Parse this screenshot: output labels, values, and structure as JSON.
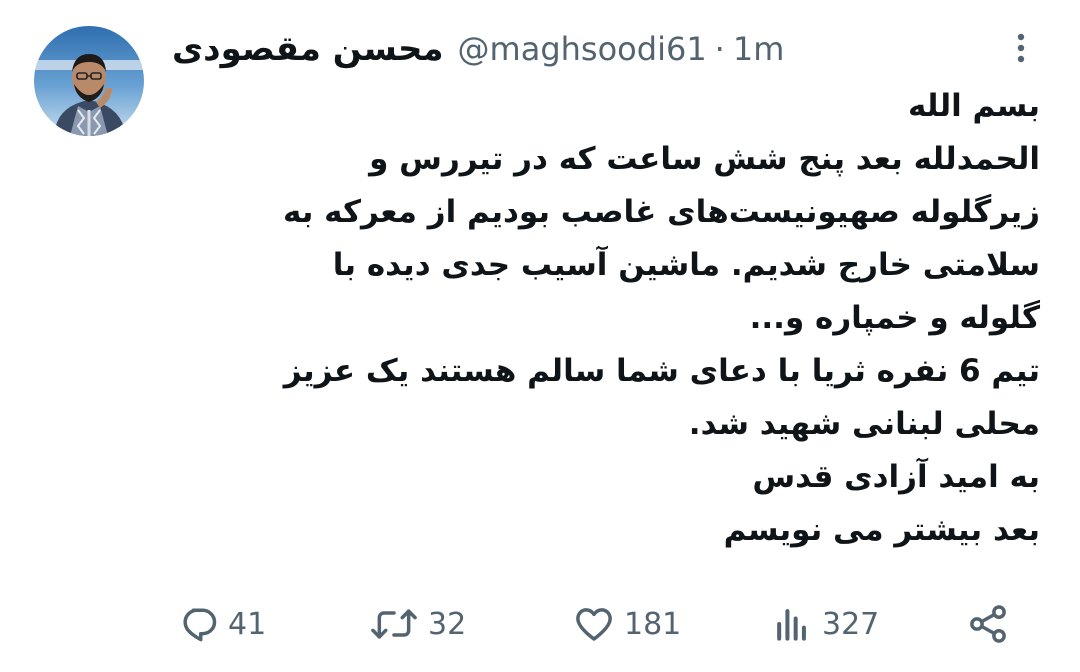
{
  "tweet": {
    "display_name": "محسن مقصودی",
    "handle": "@maghsoodi61",
    "separator": "·",
    "time": "1m",
    "more_icon": "more-dots-vertical-icon",
    "body_lines": [
      "بسم الله",
      "الحمدلله بعد پنج شش ساعت که در تیررس و",
      "زیرگلوله صهیونیست‌های غاصب بودیم از معرکه به",
      "سلامتی خارج شدیم. ماشین آسیب جدی دیده با",
      "گلوله و خمپاره و...",
      "تیم 6 نفره ثریا با دعای شما سالم هستند یک عزیز",
      "محلی لبنانی شهید شد.",
      "به امید آزادی قدس",
      "بعد بیشتر می نویسم"
    ],
    "actions": {
      "replies": "41",
      "retweets": "32",
      "likes": "181",
      "views": "327"
    }
  },
  "colors": {
    "text": "#0f1419",
    "secondary": "#536471",
    "background": "#ffffff"
  }
}
